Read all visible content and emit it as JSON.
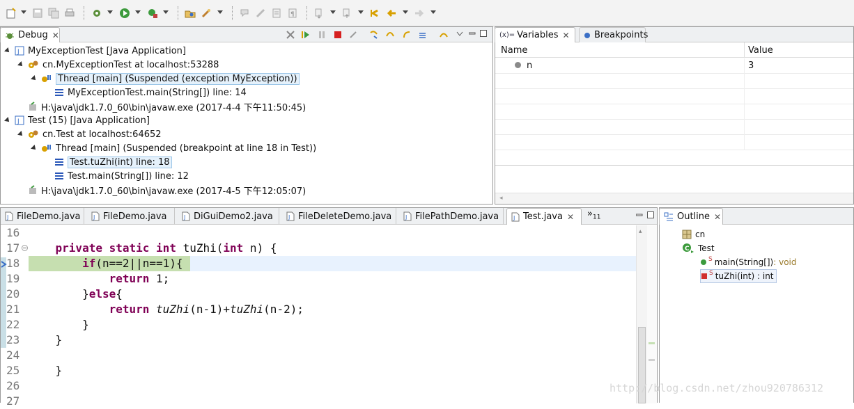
{
  "toolbar": {
    "icons": [
      "new-icon",
      "save-icon",
      "save-all-icon",
      "print-icon",
      "debug-settings-icon",
      "run-icon",
      "external-tools-icon",
      "open-type-icon",
      "open-task-icon",
      "annotation-icon",
      "pen-icon",
      "toggle-block-icon",
      "show-whitespace-icon",
      "next-annotation-icon",
      "prev-annotation-icon",
      "last-edit-icon",
      "back-icon",
      "forward-icon"
    ]
  },
  "debug_view": {
    "tab_label": "Debug",
    "close_glyph": "✕",
    "tree": [
      {
        "label": "MyExceptionTest [Java Application]",
        "icon": "java-app-icon",
        "level": 0,
        "expanded": true
      },
      {
        "label": "cn.MyExceptionTest at localhost:53288",
        "icon": "vm-icon",
        "level": 1,
        "expanded": true
      },
      {
        "label": "Thread [main] (Suspended (exception MyException))",
        "icon": "thread-icon",
        "level": 2,
        "expanded": true,
        "boxed": true
      },
      {
        "label": "MyExceptionTest.main(String[]) line: 14",
        "icon": "stack-frame-icon",
        "level": 3
      },
      {
        "label": "H:\\java\\jdk1.7.0_60\\bin\\javaw.exe (2017-4-4 下午11:50:45)",
        "icon": "process-icon",
        "level": 1
      },
      {
        "label": "Test (15) [Java Application]",
        "icon": "java-app-icon",
        "level": 0,
        "expanded": true
      },
      {
        "label": "cn.Test at localhost:64652",
        "icon": "vm-icon",
        "level": 1,
        "expanded": true
      },
      {
        "label": "Thread [main] (Suspended (breakpoint at line 18 in Test))",
        "icon": "thread-icon",
        "level": 2,
        "expanded": true
      },
      {
        "label": "Test.tuZhi(int) line: 18",
        "icon": "stack-frame-icon",
        "level": 3,
        "selected": true
      },
      {
        "label": "Test.main(String[]) line: 12",
        "icon": "stack-frame-icon",
        "level": 3
      },
      {
        "label": "H:\\java\\jdk1.7.0_60\\bin\\javaw.exe (2017-4-5 下午12:05:07)",
        "icon": "process-icon",
        "level": 1
      }
    ]
  },
  "variables_view": {
    "tabs": [
      {
        "label": "Variables",
        "prefix": "(x)=",
        "active": true
      },
      {
        "label": "Breakpoints",
        "active": false
      }
    ],
    "close_glyph": "✕",
    "columns": [
      "Name",
      "Value"
    ],
    "rows": [
      {
        "name": "n",
        "value": "3"
      }
    ]
  },
  "editor": {
    "tabs": [
      {
        "label": "FileDemo.java"
      },
      {
        "label": "FileDemo.java"
      },
      {
        "label": "DiGuiDemo2.java"
      },
      {
        "label": "FileDeleteDemo.java"
      },
      {
        "label": "FilePathDemo.java"
      },
      {
        "label": "Test.java",
        "active": true
      }
    ],
    "overflow_label": "»",
    "overflow_count": "11",
    "close_glyph": "✕",
    "lines": [
      {
        "num": "16",
        "html": ""
      },
      {
        "num": "17",
        "html": "    <span class='kw'>private</span> <span class='kw'>static</span> <span class='kw'>int</span> tuZhi(<span class='kw'>int</span> n) {"
      },
      {
        "num": "18",
        "html": "        <span class='kw'>if</span>(n==2||n==1){",
        "current": true
      },
      {
        "num": "19",
        "html": "            <span class='kw'>return</span> 1;"
      },
      {
        "num": "20",
        "html": "        }<span class='kw'>else</span>{"
      },
      {
        "num": "21",
        "html": "            <span class='kw'>return</span> <span class='it'>tuZhi</span>(n-1)+<span class='it'>tuZhi</span>(n-2);"
      },
      {
        "num": "22",
        "html": "        }"
      },
      {
        "num": "23",
        "html": "    }"
      },
      {
        "num": "24",
        "html": ""
      },
      {
        "num": "25",
        "html": "    }"
      },
      {
        "num": "26",
        "html": ""
      },
      {
        "num": "27",
        "html": ""
      }
    ]
  },
  "outline_view": {
    "tab_label": "Outline",
    "close_glyph": "✕",
    "items": [
      {
        "label": "cn",
        "icon": "package-icon"
      },
      {
        "label": "Test",
        "icon": "class-icon"
      },
      {
        "label": "main(String[])",
        "suffix": " : void",
        "static_mark": "S",
        "icon": "public-method-icon"
      },
      {
        "label": "tuZhi(int) : int",
        "suffix": "",
        "static_mark": "S",
        "icon": "private-method-icon",
        "selected": true
      }
    ]
  },
  "watermark": "http://blog.csdn.net/zhou920786312"
}
